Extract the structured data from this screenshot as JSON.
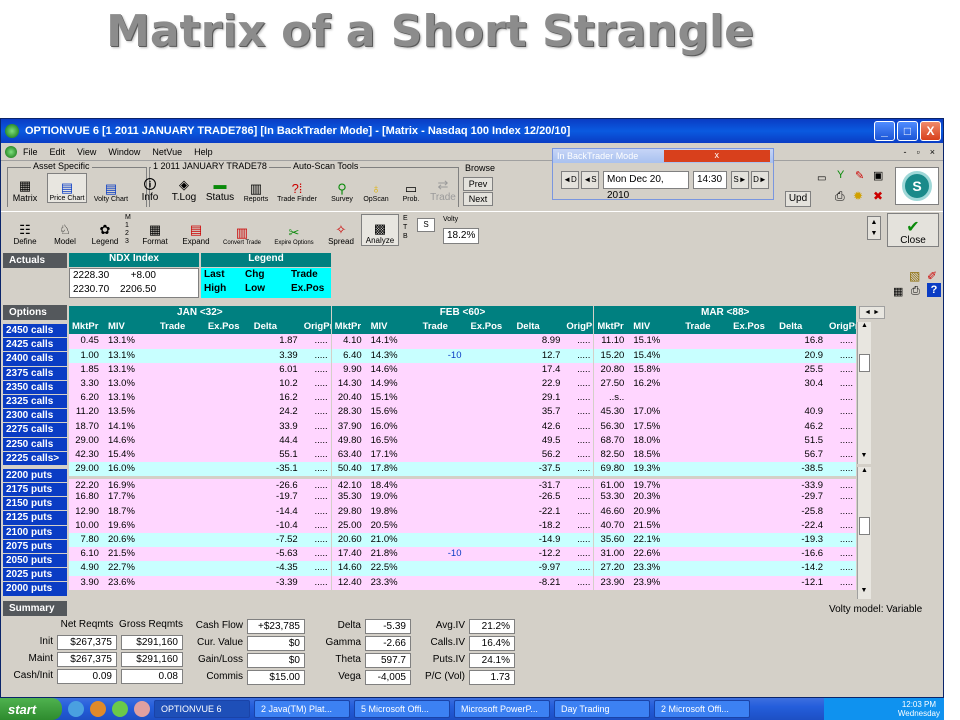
{
  "slide_title": "Matrix of a Short Strangle",
  "window": {
    "title": "OPTIONVUE 6   [1 2011 JANUARY TRADE786]   [In BackTrader Mode] - [Matrix - Nasdaq 100 Index 12/20/10]",
    "minimize": "_",
    "maximize": "□",
    "close": "X"
  },
  "menu": [
    "File",
    "Edit",
    "View",
    "Window",
    "NetVue",
    "Help"
  ],
  "mdi_buttons": [
    "-",
    "▫",
    "×"
  ],
  "toolbar1": {
    "group_asset": "Asset Specific",
    "group_trade": "1 2011 JANUARY TRADE78",
    "group_autoscan": "Auto-Scan Tools",
    "group_browse": "Browse",
    "buttons": [
      {
        "label": "Matrix",
        "icon": "grid-icon"
      },
      {
        "label": "Price Chart",
        "icon": "chart-icon"
      },
      {
        "label": "Volty Chart",
        "icon": "chart-icon"
      },
      {
        "label": "Info",
        "icon": "info-icon"
      },
      {
        "label": "T.Log",
        "icon": "log-icon"
      },
      {
        "label": "Status",
        "icon": "status-icon"
      },
      {
        "label": "Reports",
        "icon": "report-icon"
      },
      {
        "label": "Trade Finder",
        "icon": "finder-icon"
      },
      {
        "label": "Survey",
        "icon": "survey-icon"
      },
      {
        "label": "OpScan",
        "icon": "bulb-icon"
      },
      {
        "label": "Prob.",
        "icon": "prob-icon"
      },
      {
        "label": "Trade",
        "icon": "trade-icon"
      }
    ],
    "prev": "Prev",
    "next": "Next",
    "upd": "Upd",
    "logo": "S"
  },
  "backtrader": {
    "title": "In BackTrader Mode",
    "close": "x",
    "nav_dd": "◄D",
    "nav_sd": "◄S",
    "date": "Mon Dec 20, 2010",
    "time": "14:30",
    "nav_sf": "S►",
    "nav_df": "D►"
  },
  "toolbar2": {
    "buttons": [
      {
        "label": "Define",
        "icon": "define-icon"
      },
      {
        "label": "Model",
        "icon": "model-icon"
      },
      {
        "label": "Legend",
        "icon": "legend-icon"
      },
      {
        "label": "Format",
        "icon": "format-icon"
      },
      {
        "label": "Expand",
        "icon": "expand-icon"
      },
      {
        "label": "Convert Trade",
        "icon": "convert-icon"
      },
      {
        "label": "Expire Options",
        "icon": "expire-icon"
      },
      {
        "label": "Spread",
        "icon": "spread-icon"
      },
      {
        "label": "Analyze",
        "icon": "analyze-icon"
      }
    ],
    "m_stack": "M\n1\n2\n3",
    "e_stack": "E\nT\nB",
    "s_box": "S",
    "volty_label": "Volty",
    "volty_value": "18.2%",
    "close": "Close"
  },
  "actuals": {
    "label": "Actuals",
    "ndx_header": "NDX Index",
    "legend_header": "Legend",
    "ndx_rows": [
      [
        "2228.30",
        "+8.00"
      ],
      [
        "2230.70",
        "2206.50"
      ]
    ],
    "legend_rows": [
      [
        "Last",
        "Chg",
        "Trade"
      ],
      [
        "High",
        "Low",
        "Ex.Pos"
      ]
    ]
  },
  "options": {
    "label": "Options",
    "months": [
      "JAN <32>",
      "FEB <60>",
      "MAR <88>"
    ],
    "columns": [
      "MktPr",
      "MIV",
      "Trade",
      "Ex.Pos",
      "Delta",
      "OrigPr"
    ],
    "row_labels": [
      "2450 calls",
      "2425 calls",
      "2400 calls",
      "2375 calls",
      "2350 calls",
      "2325 calls",
      "2300 calls",
      "2275 calls",
      "2250 calls",
      "2225 calls>",
      "2200 puts",
      "2175 puts",
      "2150 puts",
      "2125 puts",
      "2100 puts",
      "2075 puts",
      "2050 puts",
      "2025 puts",
      "2000 puts"
    ],
    "rows": [
      [
        [
          "0.45",
          "13.1%",
          "",
          "",
          "1.87",
          "....."
        ],
        [
          "4.10",
          "14.1%",
          "",
          "",
          "8.99",
          "....."
        ],
        [
          "11.10",
          "15.1%",
          "",
          "",
          "16.8",
          "....."
        ]
      ],
      [
        [
          "1.00",
          "13.1%",
          "",
          "",
          "3.39",
          "....."
        ],
        [
          "6.40",
          "14.3%",
          "-10",
          "",
          "12.7",
          "....."
        ],
        [
          "15.20",
          "15.4%",
          "",
          "",
          "20.9",
          "....."
        ]
      ],
      [
        [
          "1.85",
          "13.1%",
          "",
          "",
          "6.01",
          "....."
        ],
        [
          "9.90",
          "14.6%",
          "",
          "",
          "17.4",
          "....."
        ],
        [
          "20.80",
          "15.8%",
          "",
          "",
          "25.5",
          "....."
        ]
      ],
      [
        [
          "3.30",
          "13.0%",
          "",
          "",
          "10.2",
          "....."
        ],
        [
          "14.30",
          "14.9%",
          "",
          "",
          "22.9",
          "....."
        ],
        [
          "27.50",
          "16.2%",
          "",
          "",
          "30.4",
          "....."
        ]
      ],
      [
        [
          "6.20",
          "13.1%",
          "",
          "",
          "16.2",
          "....."
        ],
        [
          "20.40",
          "15.1%",
          "",
          "",
          "29.1",
          "....."
        ],
        [
          "..s..",
          "",
          "",
          "",
          "",
          "....."
        ]
      ],
      [
        [
          "11.20",
          "13.5%",
          "",
          "",
          "24.2",
          "....."
        ],
        [
          "28.30",
          "15.6%",
          "",
          "",
          "35.7",
          "....."
        ],
        [
          "45.30",
          "17.0%",
          "",
          "",
          "40.9",
          "....."
        ]
      ],
      [
        [
          "18.70",
          "14.1%",
          "",
          "",
          "33.9",
          "....."
        ],
        [
          "37.90",
          "16.0%",
          "",
          "",
          "42.6",
          "....."
        ],
        [
          "56.30",
          "17.5%",
          "",
          "",
          "46.2",
          "....."
        ]
      ],
      [
        [
          "29.00",
          "14.6%",
          "",
          "",
          "44.4",
          "....."
        ],
        [
          "49.80",
          "16.5%",
          "",
          "",
          "49.5",
          "....."
        ],
        [
          "68.70",
          "18.0%",
          "",
          "",
          "51.5",
          "....."
        ]
      ],
      [
        [
          "42.30",
          "15.4%",
          "",
          "",
          "55.1",
          "....."
        ],
        [
          "63.40",
          "17.1%",
          "",
          "",
          "56.2",
          "....."
        ],
        [
          "82.50",
          "18.5%",
          "",
          "",
          "56.7",
          "....."
        ]
      ],
      [
        [
          "29.00",
          "16.0%",
          "",
          "",
          "-35.1",
          "....."
        ],
        [
          "50.40",
          "17.8%",
          "",
          "",
          "-37.5",
          "....."
        ],
        [
          "69.80",
          "19.3%",
          "",
          "",
          "-38.5",
          "....."
        ]
      ],
      [
        [
          "22.20",
          "16.9%",
          "",
          "",
          "-26.6",
          "....."
        ],
        [
          "42.10",
          "18.4%",
          "",
          "",
          "-31.7",
          "....."
        ],
        [
          "61.00",
          "19.7%",
          "",
          "",
          "-33.9",
          "....."
        ]
      ],
      [
        [
          "16.80",
          "17.7%",
          "",
          "",
          "-19.7",
          "....."
        ],
        [
          "35.30",
          "19.0%",
          "",
          "",
          "-26.5",
          "....."
        ],
        [
          "53.30",
          "20.3%",
          "",
          "",
          "-29.7",
          "....."
        ]
      ],
      [
        [
          "12.90",
          "18.7%",
          "",
          "",
          "-14.4",
          "....."
        ],
        [
          "29.80",
          "19.8%",
          "",
          "",
          "-22.1",
          "....."
        ],
        [
          "46.60",
          "20.9%",
          "",
          "",
          "-25.8",
          "....."
        ]
      ],
      [
        [
          "10.00",
          "19.6%",
          "",
          "",
          "-10.4",
          "....."
        ],
        [
          "25.00",
          "20.5%",
          "",
          "",
          "-18.2",
          "....."
        ],
        [
          "40.70",
          "21.5%",
          "",
          "",
          "-22.4",
          "....."
        ]
      ],
      [
        [
          "7.80",
          "20.6%",
          "",
          "",
          "-7.52",
          "....."
        ],
        [
          "20.60",
          "21.0%",
          "",
          "",
          "-14.9",
          "....."
        ],
        [
          "35.60",
          "22.1%",
          "",
          "",
          "-19.3",
          "....."
        ]
      ],
      [
        [
          "6.10",
          "21.5%",
          "",
          "",
          "-5.63",
          "....."
        ],
        [
          "17.40",
          "21.8%",
          "-10",
          "",
          "-12.2",
          "....."
        ],
        [
          "31.00",
          "22.6%",
          "",
          "",
          "-16.6",
          "....."
        ]
      ],
      [
        [
          "4.90",
          "22.7%",
          "",
          "",
          "-4.35",
          "....."
        ],
        [
          "14.60",
          "22.5%",
          "",
          "",
          "-9.97",
          "....."
        ],
        [
          "27.20",
          "23.3%",
          "",
          "",
          "-14.2",
          "....."
        ]
      ],
      [
        [
          "3.90",
          "23.6%",
          "",
          "",
          "-3.39",
          "....."
        ],
        [
          "12.40",
          "23.3%",
          "",
          "",
          "-8.21",
          "....."
        ],
        [
          "23.90",
          "23.9%",
          "",
          "",
          "-12.1",
          "....."
        ]
      ]
    ],
    "row_shading": [
      "pink",
      "cyan",
      "pink",
      "pink",
      "pink",
      "pink",
      "pink",
      "pink",
      "pink",
      "cyan",
      "pink",
      "pink",
      "pink",
      "pink",
      "cyan",
      "pink",
      "cyan",
      "pink",
      "white"
    ]
  },
  "summary": {
    "label": "Summary",
    "volty_model": "Volty model: Variable",
    "net_header": "Net Reqmts",
    "gross_header": "Gross Reqmts",
    "req_rows": [
      {
        "label": "Init",
        "net": "$267,375",
        "gross": "$291,160"
      },
      {
        "label": "Maint",
        "net": "$267,375",
        "gross": "$291,160"
      },
      {
        "label": "Cash/Init",
        "net": "0.09",
        "gross": "0.08"
      }
    ],
    "cash_rows": [
      {
        "label": "Cash Flow",
        "value": "+$23,785"
      },
      {
        "label": "Cur. Value",
        "value": "$0"
      },
      {
        "label": "Gain/Loss",
        "value": "$0"
      },
      {
        "label": "Commis",
        "value": "$15.00"
      }
    ],
    "greek_rows": [
      {
        "label": "Delta",
        "value": "-5.39"
      },
      {
        "label": "Gamma",
        "value": "-2.66"
      },
      {
        "label": "Theta",
        "value": "597.7"
      },
      {
        "label": "Vega",
        "value": "-4,005"
      }
    ],
    "iv_rows": [
      {
        "label": "Avg.IV",
        "value": "21.2%"
      },
      {
        "label": "Calls.IV",
        "value": "16.4%"
      },
      {
        "label": "Puts.IV",
        "value": "24.1%"
      },
      {
        "label": "P/C (Vol)",
        "value": "1.73"
      }
    ]
  },
  "taskbar": {
    "start": "start",
    "tasks": [
      "OPTIONVUE 6",
      "2 Java(TM) Plat...",
      "5 Microsoft Offi...",
      "Microsoft PowerP...",
      "Day Trading",
      "2 Microsoft Offi..."
    ],
    "clock_time": "12:03 PM",
    "clock_day": "Wednesday"
  },
  "colors": {
    "pink": "#ffd6ff",
    "cyan": "#c8ffff",
    "white": "#ffffff",
    "teal": "#008080",
    "rowlabel_blue": "#0a3cc4"
  }
}
